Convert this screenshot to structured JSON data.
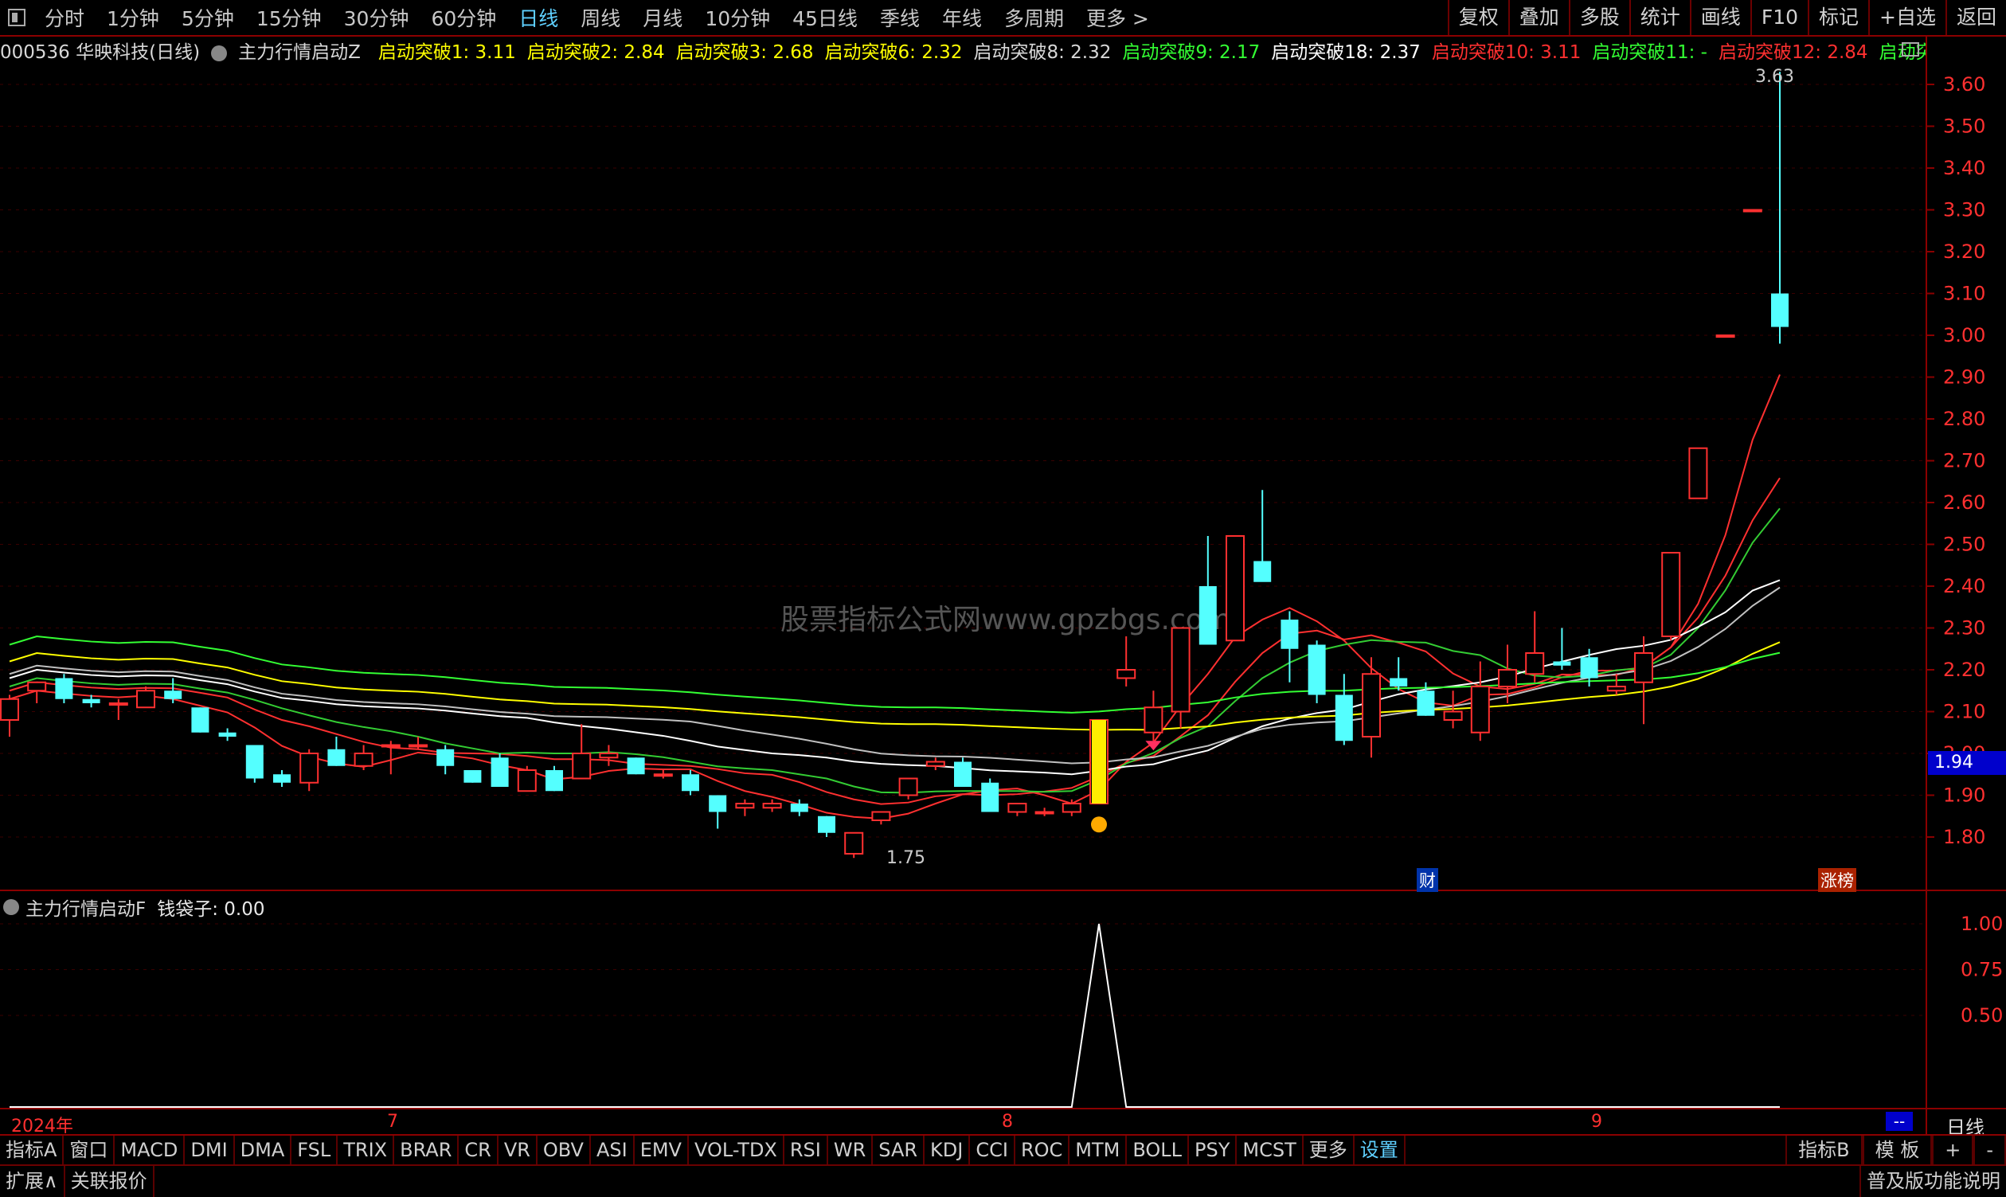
{
  "toolbar": {
    "periods": [
      "分时",
      "1分钟",
      "5分钟",
      "15分钟",
      "30分钟",
      "60分钟",
      "日线",
      "周线",
      "月线",
      "10分钟",
      "45日线",
      "季线",
      "年线",
      "多周期",
      "更多 >"
    ],
    "active_period": "日线",
    "right_buttons": [
      "复权",
      "叠加",
      "多股",
      "统计",
      "画线",
      "F10",
      "标记",
      "+自选",
      "返回"
    ]
  },
  "legend": {
    "stock": "000536 华映科技(日线)",
    "indicator": "主力行情启动Z",
    "items": [
      {
        "label": "启动突破1: 3.11",
        "color": "#ffff00"
      },
      {
        "label": "启动突破2: 2.84",
        "color": "#ffff00"
      },
      {
        "label": "启动突破3: 2.68",
        "color": "#ffff00"
      },
      {
        "label": "启动突破6: 2.32",
        "color": "#ffff00"
      },
      {
        "label": "启动突破8: 2.32",
        "color": "#d8d8d8"
      },
      {
        "label": "启动突破9: 2.17",
        "color": "#33ff33"
      },
      {
        "label": "启动突破18: 2.37",
        "color": "#ffffff"
      },
      {
        "label": "启动突破10: 3.11",
        "color": "#ff3030"
      },
      {
        "label": "启动突破11: -",
        "color": "#33ff33"
      },
      {
        "label": "启动突破12: 2.84",
        "color": "#ff3030"
      },
      {
        "label": "启动突◇",
        "color": "#33ff33"
      }
    ]
  },
  "price_axis": {
    "ticks": [
      "3.60",
      "3.50",
      "3.40",
      "3.30",
      "3.20",
      "3.10",
      "3.00",
      "2.90",
      "2.80",
      "2.70",
      "2.60",
      "2.50",
      "2.40",
      "2.30",
      "2.20",
      "2.10",
      "2.00",
      "1.90",
      "1.80"
    ],
    "current_price": "1.94",
    "high_label": "3.63",
    "low_label": "1.75"
  },
  "markers": {
    "cai": "财",
    "zhangbang": "涨榜"
  },
  "watermark": "股票指标公式网www.gpzbgs.com",
  "sub_panel": {
    "indicator": "主力行情启动F",
    "value_label": "钱袋子: 0.00",
    "ticks": [
      "1.00",
      "0.75",
      "0.50"
    ]
  },
  "time_axis": {
    "labels": [
      {
        "text": "2024年",
        "color": "#ff3030"
      },
      {
        "text": "7",
        "color": "#ff3030"
      },
      {
        "text": "8",
        "color": "#ff3030"
      },
      {
        "text": "9",
        "color": "#ff3030"
      }
    ],
    "corner_label": "日线",
    "dash_label": "--"
  },
  "bottom_tabs": [
    "指标A",
    "窗口",
    "MACD",
    "DMI",
    "DMA",
    "FSL",
    "TRIX",
    "BRAR",
    "CR",
    "VR",
    "OBV",
    "ASI",
    "EMV",
    "VOL-TDX",
    "RSI",
    "WR",
    "SAR",
    "KDJ",
    "CCI",
    "ROC",
    "MTM",
    "BOLL",
    "PSY",
    "MCST",
    "更多",
    "设置"
  ],
  "bottom_right": [
    "指标B",
    "模 板",
    "+",
    "-"
  ],
  "status": {
    "expand": "扩展∧",
    "related": "关联报价",
    "right": "普及版功能说明"
  },
  "colors": {
    "up": "#ff3030",
    "down": "#54ffff",
    "frame": "#8b0000",
    "active": "#5fd0ff"
  },
  "chart_data": {
    "type": "candlestick",
    "price_range": [
      1.75,
      3.63
    ],
    "candles": [
      {
        "o": 2.08,
        "h": 2.14,
        "l": 2.04,
        "c": 2.13
      },
      {
        "o": 2.15,
        "h": 2.17,
        "l": 2.12,
        "c": 2.17
      },
      {
        "o": 2.18,
        "h": 2.19,
        "l": 2.12,
        "c": 2.13
      },
      {
        "o": 2.13,
        "h": 2.14,
        "l": 2.11,
        "c": 2.12
      },
      {
        "o": 2.12,
        "h": 2.13,
        "l": 2.08,
        "c": 2.12
      },
      {
        "o": 2.11,
        "h": 2.16,
        "l": 2.11,
        "c": 2.15
      },
      {
        "o": 2.15,
        "h": 2.18,
        "l": 2.12,
        "c": 2.13
      },
      {
        "o": 2.11,
        "h": 2.11,
        "l": 2.05,
        "c": 2.05
      },
      {
        "o": 2.05,
        "h": 2.06,
        "l": 2.03,
        "c": 2.04
      },
      {
        "o": 2.02,
        "h": 2.02,
        "l": 1.93,
        "c": 1.94
      },
      {
        "o": 1.95,
        "h": 1.96,
        "l": 1.92,
        "c": 1.93
      },
      {
        "o": 1.93,
        "h": 2.01,
        "l": 1.91,
        "c": 2.0
      },
      {
        "o": 2.01,
        "h": 2.04,
        "l": 1.97,
        "c": 1.97
      },
      {
        "o": 1.97,
        "h": 2.02,
        "l": 1.96,
        "c": 2.0
      },
      {
        "o": 2.02,
        "h": 2.03,
        "l": 1.95,
        "c": 2.02
      },
      {
        "o": 2.02,
        "h": 2.04,
        "l": 2.01,
        "c": 2.02
      },
      {
        "o": 2.01,
        "h": 2.02,
        "l": 1.95,
        "c": 1.97
      },
      {
        "o": 1.96,
        "h": 1.96,
        "l": 1.93,
        "c": 1.93
      },
      {
        "o": 1.99,
        "h": 2.0,
        "l": 1.92,
        "c": 1.92
      },
      {
        "o": 1.91,
        "h": 1.97,
        "l": 1.91,
        "c": 1.96
      },
      {
        "o": 1.96,
        "h": 1.97,
        "l": 1.91,
        "c": 1.91
      },
      {
        "o": 1.94,
        "h": 2.07,
        "l": 1.94,
        "c": 2.0
      },
      {
        "o": 1.99,
        "h": 2.02,
        "l": 1.97,
        "c": 2.0
      },
      {
        "o": 1.99,
        "h": 1.99,
        "l": 1.95,
        "c": 1.95
      },
      {
        "o": 1.95,
        "h": 1.96,
        "l": 1.94,
        "c": 1.95
      },
      {
        "o": 1.95,
        "h": 1.96,
        "l": 1.9,
        "c": 1.91
      },
      {
        "o": 1.9,
        "h": 1.9,
        "l": 1.82,
        "c": 1.86
      },
      {
        "o": 1.87,
        "h": 1.89,
        "l": 1.85,
        "c": 1.88
      },
      {
        "o": 1.87,
        "h": 1.89,
        "l": 1.86,
        "c": 1.88
      },
      {
        "o": 1.88,
        "h": 1.89,
        "l": 1.85,
        "c": 1.86
      },
      {
        "o": 1.85,
        "h": 1.85,
        "l": 1.8,
        "c": 1.81
      },
      {
        "o": 1.76,
        "h": 1.81,
        "l": 1.75,
        "c": 1.81
      },
      {
        "o": 1.84,
        "h": 1.86,
        "l": 1.83,
        "c": 1.86
      },
      {
        "o": 1.9,
        "h": 1.94,
        "l": 1.89,
        "c": 1.94
      },
      {
        "o": 1.97,
        "h": 1.99,
        "l": 1.96,
        "c": 1.98
      },
      {
        "o": 1.98,
        "h": 1.99,
        "l": 1.92,
        "c": 1.92
      },
      {
        "o": 1.93,
        "h": 1.94,
        "l": 1.86,
        "c": 1.86
      },
      {
        "o": 1.86,
        "h": 1.88,
        "l": 1.85,
        "c": 1.88
      },
      {
        "o": 1.86,
        "h": 1.87,
        "l": 1.85,
        "c": 1.86
      },
      {
        "o": 1.86,
        "h": 1.89,
        "l": 1.85,
        "c": 1.88
      },
      {
        "o": 1.88,
        "h": 2.08,
        "l": 1.88,
        "c": 2.08
      },
      {
        "o": 2.18,
        "h": 2.28,
        "l": 2.16,
        "c": 2.2
      },
      {
        "o": 2.05,
        "h": 2.15,
        "l": 2.03,
        "c": 2.11
      },
      {
        "o": 2.1,
        "h": 2.3,
        "l": 2.06,
        "c": 2.3
      },
      {
        "o": 2.4,
        "h": 2.52,
        "l": 2.27,
        "c": 2.26
      },
      {
        "o": 2.27,
        "h": 2.52,
        "l": 2.27,
        "c": 2.52
      },
      {
        "o": 2.46,
        "h": 2.63,
        "l": 2.44,
        "c": 2.41
      },
      {
        "o": 2.32,
        "h": 2.34,
        "l": 2.17,
        "c": 2.25
      },
      {
        "o": 2.26,
        "h": 2.27,
        "l": 2.12,
        "c": 2.14
      },
      {
        "o": 2.14,
        "h": 2.19,
        "l": 2.02,
        "c": 2.03
      },
      {
        "o": 2.04,
        "h": 2.23,
        "l": 1.99,
        "c": 2.19
      },
      {
        "o": 2.18,
        "h": 2.23,
        "l": 2.15,
        "c": 2.16
      },
      {
        "o": 2.15,
        "h": 2.17,
        "l": 2.09,
        "c": 2.09
      },
      {
        "o": 2.08,
        "h": 2.15,
        "l": 2.06,
        "c": 2.1
      },
      {
        "o": 2.05,
        "h": 2.22,
        "l": 2.03,
        "c": 2.16
      },
      {
        "o": 2.16,
        "h": 2.26,
        "l": 2.12,
        "c": 2.2
      },
      {
        "o": 2.19,
        "h": 2.34,
        "l": 2.17,
        "c": 2.24
      },
      {
        "o": 2.22,
        "h": 2.3,
        "l": 2.2,
        "c": 2.21
      },
      {
        "o": 2.23,
        "h": 2.25,
        "l": 2.16,
        "c": 2.18
      },
      {
        "o": 2.15,
        "h": 2.19,
        "l": 2.14,
        "c": 2.16
      },
      {
        "o": 2.17,
        "h": 2.28,
        "l": 2.07,
        "c": 2.24
      },
      {
        "o": 2.28,
        "h": 2.48,
        "l": 2.27,
        "c": 2.48
      },
      {
        "o": 2.61,
        "h": 2.73,
        "l": 2.61,
        "c": 2.73
      },
      {
        "o": 3.0,
        "h": 3.0,
        "l": 3.0,
        "c": 3.0
      },
      {
        "o": 3.3,
        "h": 3.3,
        "l": 3.3,
        "c": 3.3
      },
      {
        "o": 3.1,
        "h": 3.63,
        "l": 2.98,
        "c": 3.02
      }
    ],
    "sub_series": {
      "name": "钱袋子",
      "spike_index": 40,
      "spike_value": 1.0
    }
  }
}
